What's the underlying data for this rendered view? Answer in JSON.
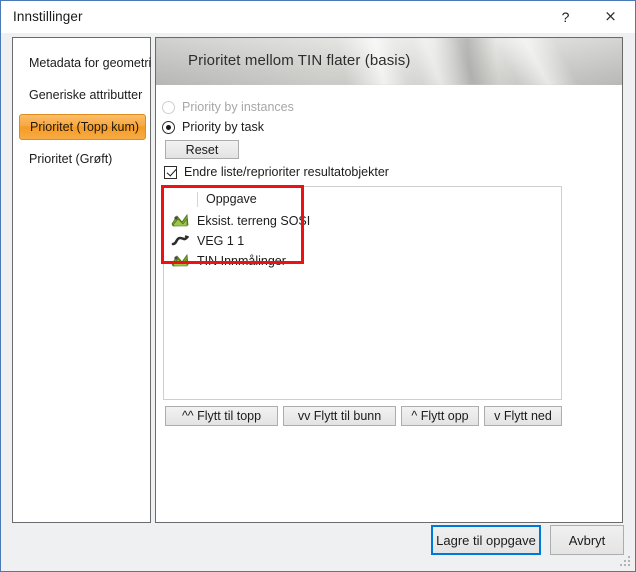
{
  "window": {
    "title": "Innstillinger",
    "help_label": "?",
    "close_label": "×",
    "border_color": "#4a7ab5"
  },
  "sidebar": {
    "items": [
      {
        "label": "Metadata for geometri",
        "selected": false
      },
      {
        "label": "Generiske attributter",
        "selected": false
      },
      {
        "label": "Prioritet (Topp kum)",
        "selected": true
      },
      {
        "label": "Prioritet (Grøft)",
        "selected": false
      }
    ],
    "selected_color": "#f59b24"
  },
  "main": {
    "banner_title": "Prioritet mellom TIN flater (basis)",
    "radios": [
      {
        "label": "Priority by instances",
        "checked": false,
        "disabled": true
      },
      {
        "label": "Priority by task",
        "checked": true,
        "disabled": false
      }
    ],
    "reset_label": "Reset",
    "checkbox": {
      "label": "Endre liste/reprioriter resultatobjekter",
      "checked": true
    },
    "list": {
      "column_header": "Oppgave",
      "rows": [
        {
          "label": "Eksist. terreng SOSI",
          "icon": "terrain-surface-icon"
        },
        {
          "label": "VEG 1 1",
          "icon": "road-alignment-icon"
        },
        {
          "label": "TIN Innmålinger",
          "icon": "terrain-surface-icon"
        }
      ]
    },
    "move_buttons": [
      {
        "label": "^^ Flytt til topp",
        "icon": "double-up-arrow-icon"
      },
      {
        "label": "vv Flytt til bunn",
        "icon": "double-down-arrow-icon"
      },
      {
        "label": "^ Flytt opp",
        "icon": "up-arrow-icon"
      },
      {
        "label": "v Flytt ned",
        "icon": "down-arrow-icon"
      }
    ]
  },
  "footer": {
    "save_label": "Lagre til oppgave",
    "cancel_label": "Avbryt",
    "focus_color": "#0078d7"
  },
  "annotation": {
    "highlight_color": "#ee1111"
  }
}
